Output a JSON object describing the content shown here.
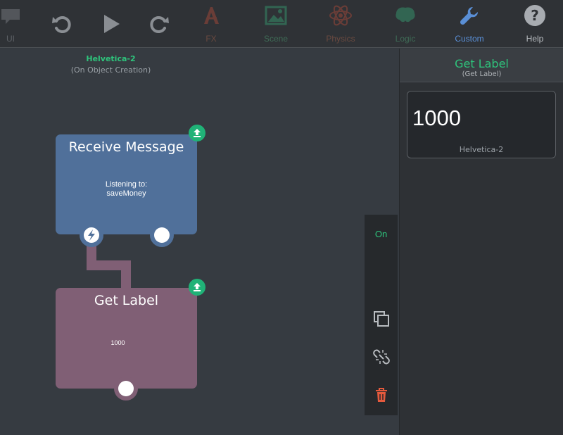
{
  "toolbar": {
    "items": [
      {
        "label": "UI",
        "icon": "speech-bubble-icon"
      },
      {
        "label": "",
        "icon": "undo-icon"
      },
      {
        "label": "",
        "icon": "play-icon"
      },
      {
        "label": "",
        "icon": "redo-icon"
      },
      {
        "label": "FX",
        "icon": "fx-icon"
      },
      {
        "label": "Scene",
        "icon": "scene-icon"
      },
      {
        "label": "Physics",
        "icon": "atom-icon"
      },
      {
        "label": "Logic",
        "icon": "brain-icon"
      },
      {
        "label": "Custom",
        "icon": "wrench-icon"
      },
      {
        "label": "Help",
        "icon": "help-icon"
      }
    ]
  },
  "canvas": {
    "object_name": "Helvetica-2",
    "trigger": "(On Object Creation)",
    "nodes": [
      {
        "title": "Receive Message",
        "body_line1": "Listening to:",
        "body_line2": "saveMoney"
      },
      {
        "title": "Get Label",
        "body_line1": "1000"
      }
    ]
  },
  "side_tools": {
    "toggle_label": "On"
  },
  "panel": {
    "title": "Get Label",
    "subtitle": "(Get Label)",
    "value": "1000",
    "source": "Helvetica-2"
  },
  "colors": {
    "accent_green": "#2ec47c",
    "custom_blue": "#5a8fd6",
    "receive_node": "#50709a",
    "getlabel_node": "#805f75",
    "delete_red": "#e55a3d"
  }
}
